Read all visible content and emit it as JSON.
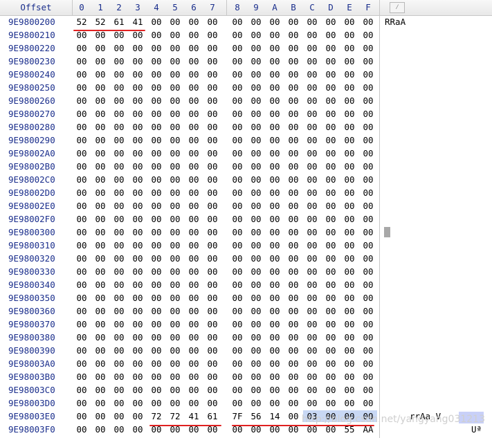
{
  "header": {
    "offset_label": "Offset",
    "columns": [
      "0",
      "1",
      "2",
      "3",
      "4",
      "5",
      "6",
      "7",
      "8",
      "9",
      "A",
      "B",
      "C",
      "D",
      "E",
      "F"
    ],
    "edit_icon_glyph": "⁄"
  },
  "rows": [
    {
      "offset": "9E9800200",
      "bytes": [
        "52",
        "52",
        "61",
        "41",
        "00",
        "00",
        "00",
        "00",
        "00",
        "00",
        "00",
        "00",
        "00",
        "00",
        "00",
        "00"
      ],
      "ascii": "RRaA"
    },
    {
      "offset": "9E9800210",
      "bytes": [
        "00",
        "00",
        "00",
        "00",
        "00",
        "00",
        "00",
        "00",
        "00",
        "00",
        "00",
        "00",
        "00",
        "00",
        "00",
        "00"
      ],
      "ascii": ""
    },
    {
      "offset": "9E9800220",
      "bytes": [
        "00",
        "00",
        "00",
        "00",
        "00",
        "00",
        "00",
        "00",
        "00",
        "00",
        "00",
        "00",
        "00",
        "00",
        "00",
        "00"
      ],
      "ascii": ""
    },
    {
      "offset": "9E9800230",
      "bytes": [
        "00",
        "00",
        "00",
        "00",
        "00",
        "00",
        "00",
        "00",
        "00",
        "00",
        "00",
        "00",
        "00",
        "00",
        "00",
        "00"
      ],
      "ascii": ""
    },
    {
      "offset": "9E9800240",
      "bytes": [
        "00",
        "00",
        "00",
        "00",
        "00",
        "00",
        "00",
        "00",
        "00",
        "00",
        "00",
        "00",
        "00",
        "00",
        "00",
        "00"
      ],
      "ascii": ""
    },
    {
      "offset": "9E9800250",
      "bytes": [
        "00",
        "00",
        "00",
        "00",
        "00",
        "00",
        "00",
        "00",
        "00",
        "00",
        "00",
        "00",
        "00",
        "00",
        "00",
        "00"
      ],
      "ascii": ""
    },
    {
      "offset": "9E9800260",
      "bytes": [
        "00",
        "00",
        "00",
        "00",
        "00",
        "00",
        "00",
        "00",
        "00",
        "00",
        "00",
        "00",
        "00",
        "00",
        "00",
        "00"
      ],
      "ascii": ""
    },
    {
      "offset": "9E9800270",
      "bytes": [
        "00",
        "00",
        "00",
        "00",
        "00",
        "00",
        "00",
        "00",
        "00",
        "00",
        "00",
        "00",
        "00",
        "00",
        "00",
        "00"
      ],
      "ascii": ""
    },
    {
      "offset": "9E9800280",
      "bytes": [
        "00",
        "00",
        "00",
        "00",
        "00",
        "00",
        "00",
        "00",
        "00",
        "00",
        "00",
        "00",
        "00",
        "00",
        "00",
        "00"
      ],
      "ascii": ""
    },
    {
      "offset": "9E9800290",
      "bytes": [
        "00",
        "00",
        "00",
        "00",
        "00",
        "00",
        "00",
        "00",
        "00",
        "00",
        "00",
        "00",
        "00",
        "00",
        "00",
        "00"
      ],
      "ascii": ""
    },
    {
      "offset": "9E98002A0",
      "bytes": [
        "00",
        "00",
        "00",
        "00",
        "00",
        "00",
        "00",
        "00",
        "00",
        "00",
        "00",
        "00",
        "00",
        "00",
        "00",
        "00"
      ],
      "ascii": ""
    },
    {
      "offset": "9E98002B0",
      "bytes": [
        "00",
        "00",
        "00",
        "00",
        "00",
        "00",
        "00",
        "00",
        "00",
        "00",
        "00",
        "00",
        "00",
        "00",
        "00",
        "00"
      ],
      "ascii": ""
    },
    {
      "offset": "9E98002C0",
      "bytes": [
        "00",
        "00",
        "00",
        "00",
        "00",
        "00",
        "00",
        "00",
        "00",
        "00",
        "00",
        "00",
        "00",
        "00",
        "00",
        "00"
      ],
      "ascii": ""
    },
    {
      "offset": "9E98002D0",
      "bytes": [
        "00",
        "00",
        "00",
        "00",
        "00",
        "00",
        "00",
        "00",
        "00",
        "00",
        "00",
        "00",
        "00",
        "00",
        "00",
        "00"
      ],
      "ascii": ""
    },
    {
      "offset": "9E98002E0",
      "bytes": [
        "00",
        "00",
        "00",
        "00",
        "00",
        "00",
        "00",
        "00",
        "00",
        "00",
        "00",
        "00",
        "00",
        "00",
        "00",
        "00"
      ],
      "ascii": ""
    },
    {
      "offset": "9E98002F0",
      "bytes": [
        "00",
        "00",
        "00",
        "00",
        "00",
        "00",
        "00",
        "00",
        "00",
        "00",
        "00",
        "00",
        "00",
        "00",
        "00",
        "00"
      ],
      "ascii": ""
    },
    {
      "offset": "9E9800300",
      "bytes": [
        "00",
        "00",
        "00",
        "00",
        "00",
        "00",
        "00",
        "00",
        "00",
        "00",
        "00",
        "00",
        "00",
        "00",
        "00",
        "00"
      ],
      "ascii": ""
    },
    {
      "offset": "9E9800310",
      "bytes": [
        "00",
        "00",
        "00",
        "00",
        "00",
        "00",
        "00",
        "00",
        "00",
        "00",
        "00",
        "00",
        "00",
        "00",
        "00",
        "00"
      ],
      "ascii": ""
    },
    {
      "offset": "9E9800320",
      "bytes": [
        "00",
        "00",
        "00",
        "00",
        "00",
        "00",
        "00",
        "00",
        "00",
        "00",
        "00",
        "00",
        "00",
        "00",
        "00",
        "00"
      ],
      "ascii": ""
    },
    {
      "offset": "9E9800330",
      "bytes": [
        "00",
        "00",
        "00",
        "00",
        "00",
        "00",
        "00",
        "00",
        "00",
        "00",
        "00",
        "00",
        "00",
        "00",
        "00",
        "00"
      ],
      "ascii": ""
    },
    {
      "offset": "9E9800340",
      "bytes": [
        "00",
        "00",
        "00",
        "00",
        "00",
        "00",
        "00",
        "00",
        "00",
        "00",
        "00",
        "00",
        "00",
        "00",
        "00",
        "00"
      ],
      "ascii": ""
    },
    {
      "offset": "9E9800350",
      "bytes": [
        "00",
        "00",
        "00",
        "00",
        "00",
        "00",
        "00",
        "00",
        "00",
        "00",
        "00",
        "00",
        "00",
        "00",
        "00",
        "00"
      ],
      "ascii": ""
    },
    {
      "offset": "9E9800360",
      "bytes": [
        "00",
        "00",
        "00",
        "00",
        "00",
        "00",
        "00",
        "00",
        "00",
        "00",
        "00",
        "00",
        "00",
        "00",
        "00",
        "00"
      ],
      "ascii": ""
    },
    {
      "offset": "9E9800370",
      "bytes": [
        "00",
        "00",
        "00",
        "00",
        "00",
        "00",
        "00",
        "00",
        "00",
        "00",
        "00",
        "00",
        "00",
        "00",
        "00",
        "00"
      ],
      "ascii": ""
    },
    {
      "offset": "9E9800380",
      "bytes": [
        "00",
        "00",
        "00",
        "00",
        "00",
        "00",
        "00",
        "00",
        "00",
        "00",
        "00",
        "00",
        "00",
        "00",
        "00",
        "00"
      ],
      "ascii": ""
    },
    {
      "offset": "9E9800390",
      "bytes": [
        "00",
        "00",
        "00",
        "00",
        "00",
        "00",
        "00",
        "00",
        "00",
        "00",
        "00",
        "00",
        "00",
        "00",
        "00",
        "00"
      ],
      "ascii": ""
    },
    {
      "offset": "9E98003A0",
      "bytes": [
        "00",
        "00",
        "00",
        "00",
        "00",
        "00",
        "00",
        "00",
        "00",
        "00",
        "00",
        "00",
        "00",
        "00",
        "00",
        "00"
      ],
      "ascii": ""
    },
    {
      "offset": "9E98003B0",
      "bytes": [
        "00",
        "00",
        "00",
        "00",
        "00",
        "00",
        "00",
        "00",
        "00",
        "00",
        "00",
        "00",
        "00",
        "00",
        "00",
        "00"
      ],
      "ascii": ""
    },
    {
      "offset": "9E98003C0",
      "bytes": [
        "00",
        "00",
        "00",
        "00",
        "00",
        "00",
        "00",
        "00",
        "00",
        "00",
        "00",
        "00",
        "00",
        "00",
        "00",
        "00"
      ],
      "ascii": ""
    },
    {
      "offset": "9E98003D0",
      "bytes": [
        "00",
        "00",
        "00",
        "00",
        "00",
        "00",
        "00",
        "00",
        "00",
        "00",
        "00",
        "00",
        "00",
        "00",
        "00",
        "00"
      ],
      "ascii": ""
    },
    {
      "offset": "9E98003E0",
      "bytes": [
        "00",
        "00",
        "00",
        "00",
        "72",
        "72",
        "41",
        "61",
        "7F",
        "56",
        "14",
        "00",
        "03",
        "00",
        "00",
        "00"
      ],
      "ascii": "rrAa V"
    },
    {
      "offset": "9E98003F0",
      "bytes": [
        "00",
        "00",
        "00",
        "00",
        "00",
        "00",
        "00",
        "00",
        "00",
        "00",
        "00",
        "00",
        "00",
        "00",
        "55",
        "AA"
      ],
      "ascii": "Uª"
    }
  ],
  "watermark": "http://blog.csdn.net/yangyang031213",
  "colors": {
    "offset_text": "#1a2e8c",
    "selection": "#c8d8f4",
    "underline": "#e02020"
  }
}
